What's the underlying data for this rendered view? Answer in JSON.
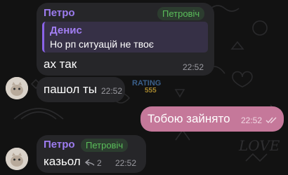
{
  "messages": [
    {
      "sender": "Петро",
      "role": "Петровіч",
      "reply": {
        "name": "Денис",
        "text": "Но рп ситуацій не твоє"
      },
      "text": "ах так",
      "time": "22:52"
    },
    {
      "text": "пашол ты",
      "time": "22:52"
    },
    {
      "direction": "outgoing",
      "text": "Тобою зайнято",
      "time": "22:52",
      "status": "read"
    },
    {
      "sender": "Петро",
      "role": "Петровіч",
      "text": "казьол",
      "reply_count": "2",
      "time": "22:52"
    }
  ],
  "colors": {
    "background": "#121212",
    "incoming_bubble": "#262629",
    "outgoing_bubble": "#c5789a",
    "sender_name": "#9d7cf0",
    "role_badge": "#5bbf5b"
  },
  "icons": [
    "cat-sticker-avatar",
    "double-check-icon",
    "reply-arrow-icon"
  ]
}
